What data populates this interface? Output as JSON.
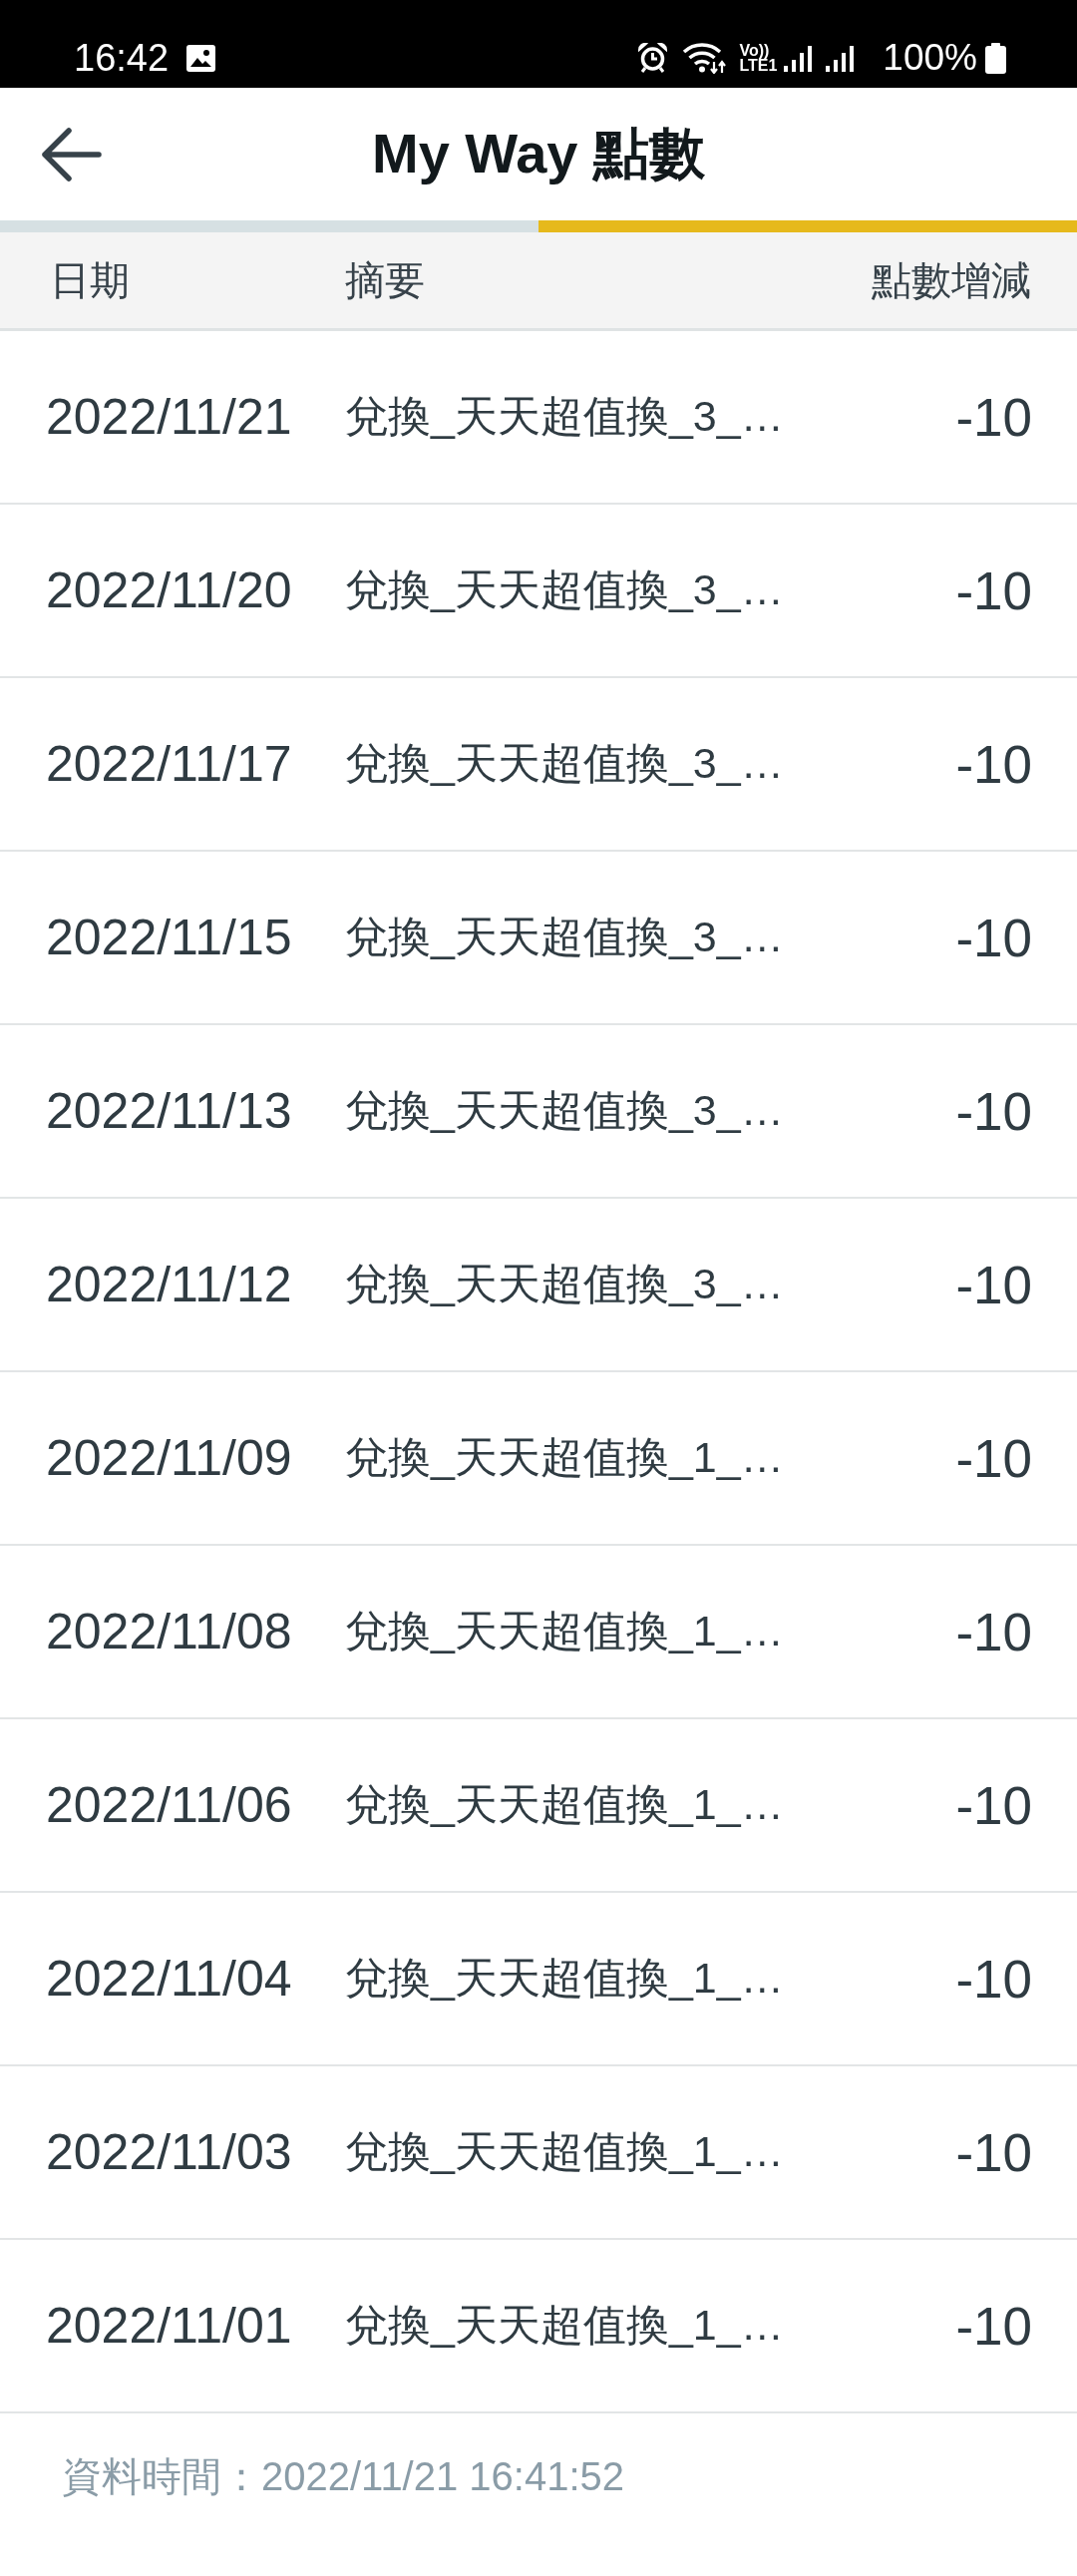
{
  "status_bar": {
    "time": "16:42",
    "volte_top": "Vo))",
    "volte_bottom": "LTE1",
    "battery": "100%"
  },
  "header": {
    "title": "My Way 點數"
  },
  "tab_indicator": [
    {
      "selected": false
    },
    {
      "selected": true
    }
  ],
  "table": {
    "columns": [
      "日期",
      "摘要",
      "點數增減"
    ],
    "rows": [
      {
        "date": "2022/11/21",
        "summary": "兌換_天天超值換_3_…",
        "points": "-10"
      },
      {
        "date": "2022/11/20",
        "summary": "兌換_天天超值換_3_…",
        "points": "-10"
      },
      {
        "date": "2022/11/17",
        "summary": "兌換_天天超值換_3_…",
        "points": "-10"
      },
      {
        "date": "2022/11/15",
        "summary": "兌換_天天超值換_3_…",
        "points": "-10"
      },
      {
        "date": "2022/11/13",
        "summary": "兌換_天天超值換_3_…",
        "points": "-10"
      },
      {
        "date": "2022/11/12",
        "summary": "兌換_天天超值換_3_…",
        "points": "-10"
      },
      {
        "date": "2022/11/09",
        "summary": "兌換_天天超值換_1_…",
        "points": "-10"
      },
      {
        "date": "2022/11/08",
        "summary": "兌換_天天超值換_1_…",
        "points": "-10"
      },
      {
        "date": "2022/11/06",
        "summary": "兌換_天天超值換_1_…",
        "points": "-10"
      },
      {
        "date": "2022/11/04",
        "summary": "兌換_天天超值換_1_…",
        "points": "-10"
      },
      {
        "date": "2022/11/03",
        "summary": "兌換_天天超值換_1_…",
        "points": "-10"
      },
      {
        "date": "2022/11/01",
        "summary": "兌換_天天超值換_1_…",
        "points": "-10"
      }
    ]
  },
  "footer": {
    "text": "資料時間：2022/11/21 16:41:52"
  }
}
